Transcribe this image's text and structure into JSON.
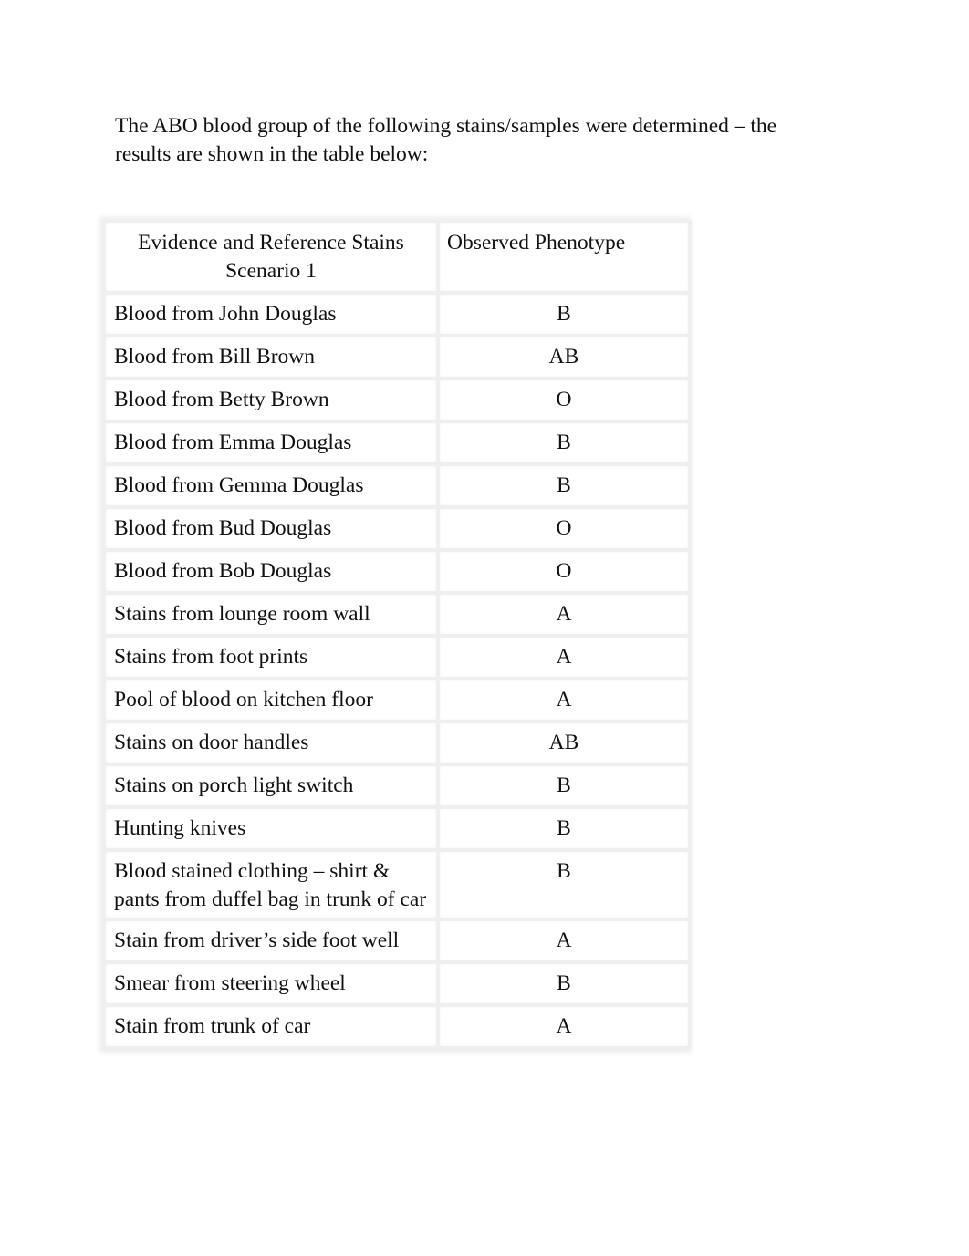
{
  "intro": "The ABO blood group of the following stains/samples were determined – the results are shown in the table below:",
  "table": {
    "headers": [
      "Evidence and Reference Stains Scenario 1",
      "Observed Phenotype"
    ],
    "rows": [
      {
        "sample": "Blood from John Douglas",
        "phenotype": "B"
      },
      {
        "sample": "Blood from Bill Brown",
        "phenotype": "AB"
      },
      {
        "sample": "Blood from Betty Brown",
        "phenotype": "O"
      },
      {
        "sample": "Blood from Emma Douglas",
        "phenotype": "B"
      },
      {
        "sample": "Blood from Gemma Douglas",
        "phenotype": "B"
      },
      {
        "sample": "Blood from Bud Douglas",
        "phenotype": "O"
      },
      {
        "sample": "Blood from Bob Douglas",
        "phenotype": "O"
      },
      {
        "sample": "Stains from lounge room wall",
        "phenotype": "A"
      },
      {
        "sample": "Stains from foot prints",
        "phenotype": "A"
      },
      {
        "sample": "Pool of blood on kitchen floor",
        "phenotype": "A"
      },
      {
        "sample": "Stains on door handles",
        "phenotype": "AB"
      },
      {
        "sample": "Stains on porch light switch",
        "phenotype": "B"
      },
      {
        "sample": "Hunting knives",
        "phenotype": "B"
      },
      {
        "sample": "Blood stained clothing – shirt & pants from duffel bag in trunk of car",
        "phenotype": "B"
      },
      {
        "sample": "Stain from driver’s side foot well",
        "phenotype": "A"
      },
      {
        "sample": "Smear from steering wheel",
        "phenotype": "B"
      },
      {
        "sample": "Stain from trunk of car",
        "phenotype": "A"
      }
    ]
  }
}
